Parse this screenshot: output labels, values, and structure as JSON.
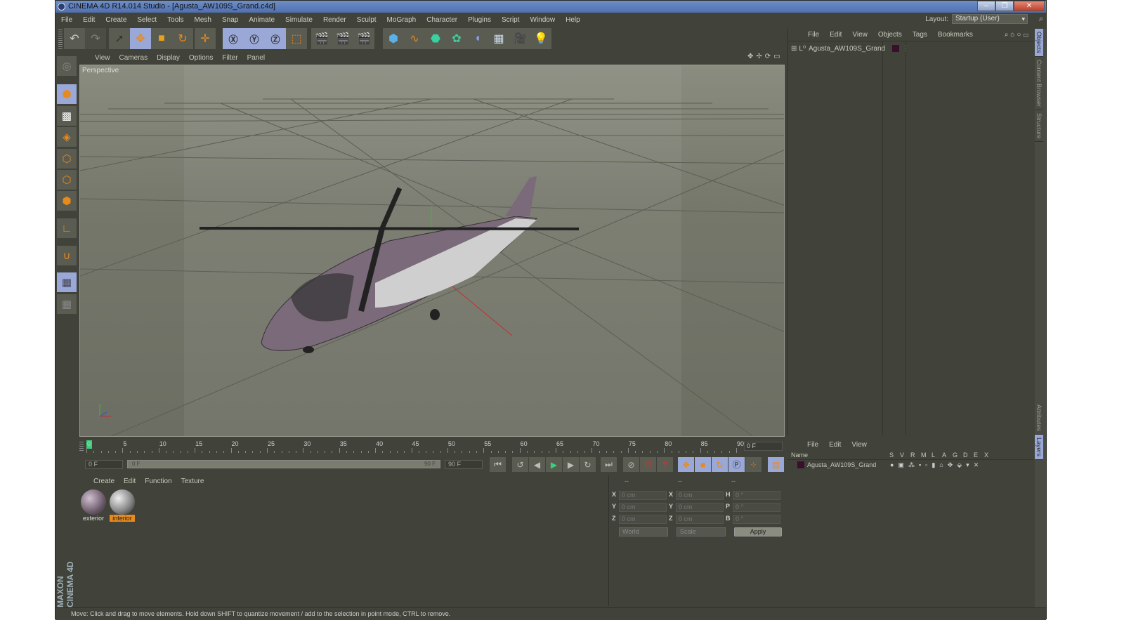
{
  "window": {
    "title": "CINEMA 4D R14.014 Studio - [Agusta_AW109S_Grand.c4d]",
    "buttons": [
      "minimize",
      "restore",
      "close"
    ]
  },
  "menubar": [
    "File",
    "Edit",
    "Create",
    "Select",
    "Tools",
    "Mesh",
    "Snap",
    "Animate",
    "Simulate",
    "Render",
    "Sculpt",
    "MoGraph",
    "Character",
    "Plugins",
    "Script",
    "Window",
    "Help"
  ],
  "layout": {
    "label": "Layout:",
    "value": "Startup (User)"
  },
  "toolbar": {
    "icons": [
      "undo-icon",
      "redo-icon",
      "live-selection-icon",
      "move-icon",
      "scale-icon",
      "rotate-icon",
      "recent-tool-icon",
      "x-axis-lock-icon",
      "y-axis-lock-icon",
      "z-axis-lock-icon",
      "coordinate-system-icon",
      "render-view-icon",
      "render-picture-viewer-icon",
      "render-settings-icon",
      "cube-icon",
      "spline-pen-icon",
      "subdivision-surface-icon",
      "cloner-icon",
      "deformer-icon",
      "floor-icon",
      "camera-icon",
      "light-icon"
    ]
  },
  "left_tools": [
    "make-editable-icon",
    "model-mode-icon",
    "texture-mode-icon",
    "workplane-mode-icon",
    "points-mode-icon",
    "edges-mode-icon",
    "polygons-mode-icon",
    "axis-mode-icon",
    "magnet-icon",
    "locked-workplane-icon",
    "planar-workplane-icon"
  ],
  "viewport": {
    "menu": [
      "View",
      "Cameras",
      "Display",
      "Options",
      "Filter",
      "Panel"
    ],
    "label": "Perspective",
    "scene_object": "helicopter"
  },
  "timeline": {
    "ticks": [
      0,
      5,
      10,
      15,
      20,
      25,
      30,
      35,
      40,
      45,
      50,
      55,
      60,
      65,
      70,
      75,
      80,
      85,
      90
    ],
    "current_frame": "0 F",
    "start_field": "0 F",
    "range_start": "0 F",
    "range_end": "90 F",
    "end_field": "90 F"
  },
  "materials": {
    "menu": [
      "Create",
      "Edit",
      "Function",
      "Texture"
    ],
    "items": [
      {
        "name": "exterior",
        "selected": false
      },
      {
        "name": "interior",
        "selected": true
      }
    ]
  },
  "coordinates": {
    "headers": [
      "--",
      "--",
      "--"
    ],
    "rows": [
      {
        "a": "X",
        "av": "0 cm",
        "b": "X",
        "bv": "0 cm",
        "c": "H",
        "cv": "0 °"
      },
      {
        "a": "Y",
        "av": "0 cm",
        "b": "Y",
        "bv": "0 cm",
        "c": "P",
        "cv": "0 °"
      },
      {
        "a": "Z",
        "av": "0 cm",
        "b": "Z",
        "bv": "0 cm",
        "c": "B",
        "cv": "0 °"
      }
    ],
    "mode": "World",
    "type": "Scale",
    "apply": "Apply"
  },
  "object_manager": {
    "menu": [
      "File",
      "Edit",
      "View",
      "Objects",
      "Tags",
      "Bookmarks"
    ],
    "objects": [
      {
        "name": "Agusta_AW109S_Grand",
        "layer_color": "#3a0f2c"
      }
    ]
  },
  "layer_manager": {
    "menu": [
      "File",
      "Edit",
      "View"
    ],
    "columns": [
      "Name",
      "S",
      "V",
      "R",
      "M",
      "L",
      "A",
      "G",
      "D",
      "E",
      "X"
    ],
    "rows": [
      {
        "name": "Agusta_AW109S_Grand"
      }
    ]
  },
  "side_tabs": [
    "Objects",
    "Content Browser",
    "Structure",
    "Attributes",
    "Layers"
  ],
  "branding": "MAXON CINEMA 4D",
  "status": "Move: Click and drag to move elements. Hold down SHIFT to quantize movement / add to the selection in point mode, CTRL to remove."
}
